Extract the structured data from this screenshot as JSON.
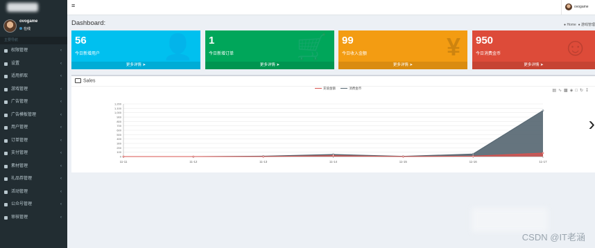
{
  "sidebar": {
    "user": {
      "name": "ovogame",
      "status": "在线"
    },
    "menu_header": "主要导航",
    "items": [
      {
        "label": "权限管理",
        "icon": "lock-icon"
      },
      {
        "label": "设置",
        "icon": "menu-icon"
      },
      {
        "label": "适用抓取",
        "icon": "menu-icon"
      },
      {
        "label": "游戏管理",
        "icon": "menu-icon"
      },
      {
        "label": "广告管理",
        "icon": "menu-icon"
      },
      {
        "label": "广告模板管理",
        "icon": "menu-icon"
      },
      {
        "label": "用户管理",
        "icon": "user-icon"
      },
      {
        "label": "订单管理",
        "icon": "menu-icon"
      },
      {
        "label": "支付管理",
        "icon": "menu-icon"
      },
      {
        "label": "素材管理",
        "icon": "menu-icon"
      },
      {
        "label": "礼品券管理",
        "icon": "menu-icon"
      },
      {
        "label": "活动管理",
        "icon": "menu-icon"
      },
      {
        "label": "公众号管理",
        "icon": "menu-icon"
      },
      {
        "label": "审核管理",
        "icon": "menu-icon"
      }
    ]
  },
  "topbar": {
    "menu_toggle": "≡",
    "user_name": "ovogame"
  },
  "page": {
    "title": "Dashboard:"
  },
  "breadcrumb": {
    "home": "Home",
    "current": "游戏管理"
  },
  "stat_boxes": [
    {
      "value": "56",
      "label": "今日新增用户",
      "footer": "更多详情",
      "icon": "user-plus-icon",
      "color": "#00c0ef"
    },
    {
      "value": "1",
      "label": "今日新增订单",
      "footer": "更多详情",
      "icon": "cart-icon",
      "color": "#00a65a"
    },
    {
      "value": "99",
      "label": "今日收入金额",
      "footer": "更多详情",
      "icon": "yen-icon",
      "color": "#f39c12"
    },
    {
      "value": "950",
      "label": "今日消费金币",
      "footer": "更多详情",
      "icon": "smile-icon",
      "color": "#dd4b39"
    }
  ],
  "sales_panel": {
    "title": "Sales"
  },
  "chart_data": {
    "type": "area",
    "title": "",
    "x": [
      "11-11",
      "11-12",
      "11-13",
      "11-14",
      "11-15",
      "11-16",
      "11-17"
    ],
    "ylim": [
      0,
      1200
    ],
    "yticks": [
      "0",
      "100",
      "200",
      "300",
      "400",
      "500",
      "600",
      "700",
      "800",
      "900",
      "1,000",
      "1,100",
      "1,200"
    ],
    "grid": true,
    "legend_position": "top-center",
    "series": [
      {
        "name": "充值金额",
        "color": "#d9534f",
        "values": [
          0,
          0,
          0,
          20,
          0,
          10,
          80
        ]
      },
      {
        "name": "消费金币",
        "color": "#546570",
        "values": [
          0,
          0,
          10,
          50,
          5,
          60,
          1050
        ]
      }
    ]
  },
  "watermark": "CSDN @IT老涵"
}
